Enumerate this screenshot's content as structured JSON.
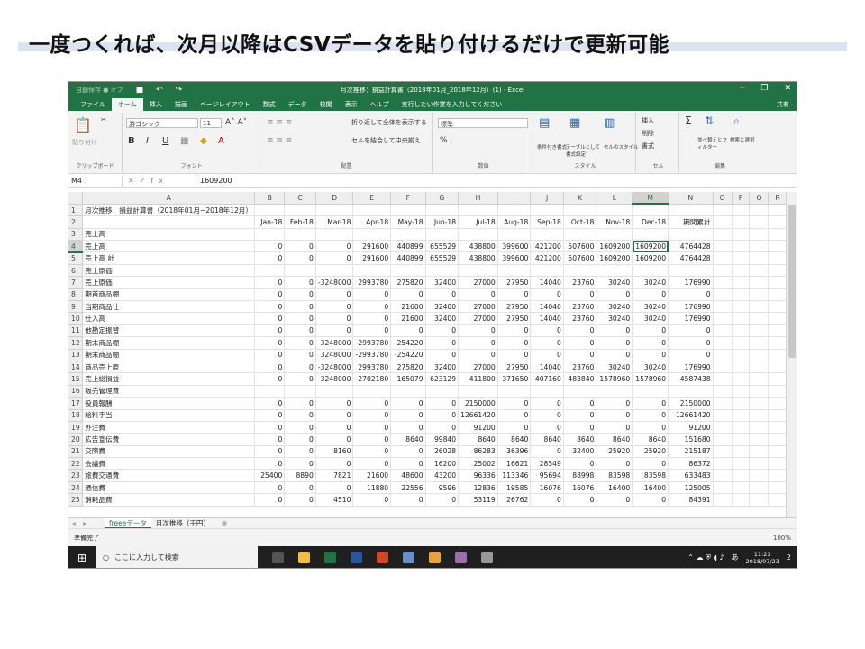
{
  "slide": {
    "title": "一度つくれば、次月以降はCSVデータを貼り付けるだけで更新可能"
  },
  "excel": {
    "autosave": "自動保存 ● オフ",
    "doc_title": "月次推移：損益計算書（2018年01月_2018年12月）(1) - Excel",
    "tabs": [
      "ファイル",
      "ホーム",
      "挿入",
      "描画",
      "ページレイアウト",
      "数式",
      "データ",
      "校閲",
      "表示",
      "ヘルプ"
    ],
    "active_tab": "ホーム",
    "tell_me": "実行したい作業を入力してください",
    "share": "共有",
    "ribbon": {
      "clipboard_label": "クリップボード",
      "paste": "貼り付け",
      "font_name": "游ゴシック",
      "font_size": "11",
      "font_label": "フォント",
      "wrap": "折り返して全体を表示する",
      "merge": "セルを結合して中央揃え",
      "align_label": "配置",
      "number_format": "標準",
      "number_label": "数値",
      "cond_format": "条件付き書式",
      "table_format": "テーブルとして書式設定",
      "cell_style": "セルのスタイル",
      "style_label": "スタイル",
      "insert": "挿入",
      "delete": "削除",
      "format": "書式",
      "cells_label": "セル",
      "sort": "並べ替えとフィルター",
      "find": "検索と選択",
      "edit_label": "編集"
    },
    "name_box": "M4",
    "formula": "1609200",
    "columns": [
      "A",
      "B",
      "C",
      "D",
      "E",
      "F",
      "G",
      "H",
      "I",
      "J",
      "K",
      "L",
      "M",
      "N",
      "O",
      "P",
      "Q",
      "R"
    ],
    "rows": [
      [
        "月次推移：損益計算書（2018年01月~2018年12月）",
        "",
        "",
        "",
        "",
        "",
        "",
        "",
        "",
        "",
        "",
        "",
        "",
        ""
      ],
      [
        "",
        "Jan-18",
        "Feb-18",
        "Mar-18",
        "Apr-18",
        "May-18",
        "Jun-18",
        "Jul-18",
        "Aug-18",
        "Sep-18",
        "Oct-18",
        "Nov-18",
        "Dec-18",
        "期間累計"
      ],
      [
        "売上高",
        "",
        "",
        "",
        "",
        "",
        "",
        "",
        "",
        "",
        "",
        "",
        "",
        ""
      ],
      [
        "売上高",
        "0",
        "0",
        "0",
        "291600",
        "440899",
        "655529",
        "438800",
        "399600",
        "421200",
        "507600",
        "1609200",
        "1609200",
        "4764428"
      ],
      [
        "売上高 計",
        "0",
        "0",
        "0",
        "291600",
        "440899",
        "655529",
        "438800",
        "399600",
        "421200",
        "507600",
        "1609200",
        "1609200",
        "4764428"
      ],
      [
        "売上原価",
        "",
        "",
        "",
        "",
        "",
        "",
        "",
        "",
        "",
        "",
        "",
        "",
        ""
      ],
      [
        "売上原価",
        "0",
        "0",
        "-3248000",
        "2993780",
        "275820",
        "32400",
        "27000",
        "27950",
        "14040",
        "23760",
        "30240",
        "30240",
        "176990"
      ],
      [
        "期首商品棚",
        "0",
        "0",
        "0",
        "0",
        "0",
        "0",
        "0",
        "0",
        "0",
        "0",
        "0",
        "0",
        "0"
      ],
      [
        "当期商品仕",
        "0",
        "0",
        "0",
        "0",
        "21600",
        "32400",
        "27000",
        "27950",
        "14040",
        "23760",
        "30240",
        "30240",
        "176990"
      ],
      [
        "仕入高",
        "0",
        "0",
        "0",
        "0",
        "21600",
        "32400",
        "27000",
        "27950",
        "14040",
        "23760",
        "30240",
        "30240",
        "176990"
      ],
      [
        "他勘定振替",
        "0",
        "0",
        "0",
        "0",
        "0",
        "0",
        "0",
        "0",
        "0",
        "0",
        "0",
        "0",
        "0"
      ],
      [
        "期末商品棚",
        "0",
        "0",
        "3248000",
        "-2993780",
        "-254220",
        "0",
        "0",
        "0",
        "0",
        "0",
        "0",
        "0",
        "0"
      ],
      [
        "期末商品棚",
        "0",
        "0",
        "3248000",
        "-2993780",
        "-254220",
        "0",
        "0",
        "0",
        "0",
        "0",
        "0",
        "0",
        "0"
      ],
      [
        "商品売上原",
        "0",
        "0",
        "-3248000",
        "2993780",
        "275820",
        "32400",
        "27000",
        "27950",
        "14040",
        "23760",
        "30240",
        "30240",
        "176990"
      ],
      [
        "売上総損益",
        "0",
        "0",
        "3248000",
        "-2702180",
        "165079",
        "623129",
        "411800",
        "371650",
        "407160",
        "483840",
        "1578960",
        "1578960",
        "4587438"
      ],
      [
        "販売管理費",
        "",
        "",
        "",
        "",
        "",
        "",
        "",
        "",
        "",
        "",
        "",
        "",
        ""
      ],
      [
        "役員報酬",
        "0",
        "0",
        "0",
        "0",
        "0",
        "0",
        "2150000",
        "0",
        "0",
        "0",
        "0",
        "0",
        "2150000"
      ],
      [
        "給料手当",
        "0",
        "0",
        "0",
        "0",
        "0",
        "0",
        "12661420",
        "0",
        "0",
        "0",
        "0",
        "0",
        "12661420"
      ],
      [
        "外注費",
        "0",
        "0",
        "0",
        "0",
        "0",
        "0",
        "91200",
        "0",
        "0",
        "0",
        "0",
        "0",
        "91200"
      ],
      [
        "広告宣伝費",
        "0",
        "0",
        "0",
        "0",
        "8640",
        "99840",
        "8640",
        "8640",
        "8640",
        "8640",
        "8640",
        "8640",
        "151680"
      ],
      [
        "交際費",
        "0",
        "0",
        "8160",
        "0",
        "0",
        "26028",
        "86283",
        "36396",
        "0",
        "32400",
        "25920",
        "25920",
        "215187"
      ],
      [
        "会議費",
        "0",
        "0",
        "0",
        "0",
        "0",
        "16200",
        "25002",
        "16621",
        "28549",
        "0",
        "0",
        "0",
        "86372"
      ],
      [
        "旅費交通費",
        "25400",
        "8890",
        "7821",
        "21600",
        "48600",
        "43200",
        "96336",
        "113346",
        "95694",
        "88998",
        "83598",
        "83598",
        "633483"
      ],
      [
        "通信費",
        "0",
        "0",
        "0",
        "11880",
        "22556",
        "9596",
        "12836",
        "19585",
        "16076",
        "16076",
        "16400",
        "16400",
        "125005"
      ],
      [
        "消耗品費",
        "0",
        "0",
        "4510",
        "0",
        "0",
        "0",
        "53119",
        "26762",
        "0",
        "0",
        "0",
        "0",
        "84391"
      ]
    ],
    "sheets": [
      "freeeデータ",
      "月次推移（千円）"
    ],
    "active_sheet": "freeeデータ",
    "status": "準備完了",
    "zoom": "100%"
  },
  "taskbar": {
    "search": "ここに入力して検索",
    "time": "11:23",
    "date": "2018/07/23",
    "ime": "あ",
    "notif": "2"
  }
}
